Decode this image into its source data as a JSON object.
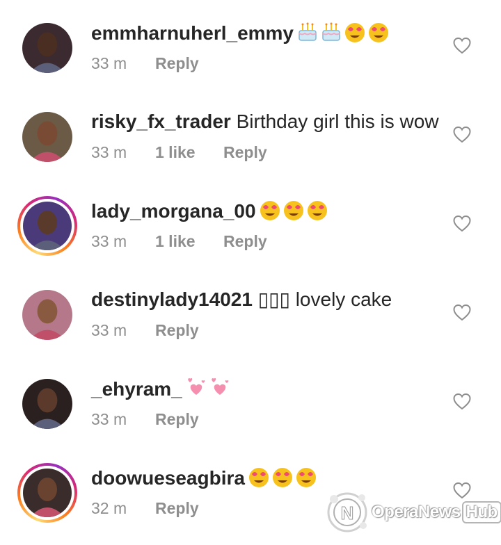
{
  "comments": [
    {
      "username": "emmharnuherl_emmy",
      "text": "",
      "emojis": [
        "cake",
        "cake",
        "heart-eyes",
        "heart-eyes"
      ],
      "time": "33 m",
      "likes": "",
      "reply": "Reply",
      "ring": false,
      "avatar_color": "#3b2a2f"
    },
    {
      "username": "risky_fx_trader",
      "text": " Birthday girl this is wow",
      "emojis": [],
      "time": "33 m",
      "likes": "1 like",
      "reply": "Reply",
      "ring": false,
      "avatar_color": "#6b5a45"
    },
    {
      "username": "lady_morgana_00",
      "text": "",
      "emojis": [
        "heart-eyes",
        "heart-eyes",
        "heart-eyes"
      ],
      "time": "33 m",
      "likes": "1 like",
      "reply": "Reply",
      "ring": true,
      "avatar_color": "#4a3a7a"
    },
    {
      "username": "destinylady14021",
      "text": " ▯▯▯ lovely cake",
      "emojis": [],
      "time": "33 m",
      "likes": "",
      "reply": "Reply",
      "ring": false,
      "avatar_color": "#b5788a"
    },
    {
      "username": "_ehyram_",
      "text": "",
      "emojis": [
        "sparkle-hearts",
        "sparkle-hearts"
      ],
      "time": "33 m",
      "likes": "",
      "reply": "Reply",
      "ring": false,
      "avatar_color": "#2a2020"
    },
    {
      "username": "doowueseagbira",
      "text": "",
      "emojis": [
        "heart-eyes",
        "heart-eyes",
        "heart-eyes"
      ],
      "time": "32 m",
      "likes": "",
      "reply": "Reply",
      "ring": true,
      "avatar_color": "#3a2c2a"
    }
  ],
  "watermark": {
    "brand": "OperaNews",
    "hub": "Hub",
    "icon": "opera-news-logo-icon"
  },
  "colors": {
    "text": "#262626",
    "meta": "#8e8e8e",
    "ring_start": "#feda75",
    "ring_end": "#962fbf"
  }
}
